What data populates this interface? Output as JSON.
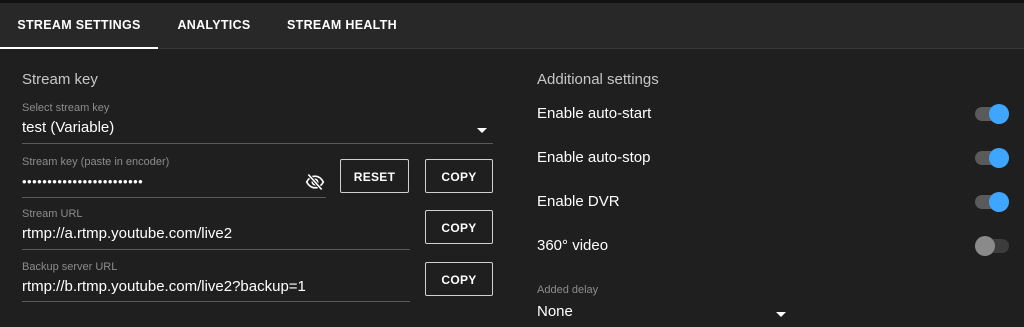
{
  "tabs": [
    {
      "label": "STREAM SETTINGS",
      "active": true
    },
    {
      "label": "ANALYTICS",
      "active": false
    },
    {
      "label": "STREAM HEALTH",
      "active": false
    }
  ],
  "stream_key": {
    "section_title": "Stream key",
    "select": {
      "label": "Select stream key",
      "value": "test (Variable)"
    },
    "key": {
      "label": "Stream key (paste in encoder)",
      "value": "••••••••••••••••••••••••"
    },
    "reset_label": "RESET",
    "copy_key_label": "COPY",
    "url": {
      "label": "Stream URL",
      "value": "rtmp://a.rtmp.youtube.com/live2"
    },
    "copy_url_label": "COPY",
    "backup": {
      "label": "Backup server URL",
      "value": "rtmp://b.rtmp.youtube.com/live2?backup=1"
    },
    "copy_backup_label": "COPY"
  },
  "additional": {
    "section_title": "Additional settings",
    "settings": [
      {
        "label": "Enable auto-start",
        "enabled": true
      },
      {
        "label": "Enable auto-stop",
        "enabled": true
      },
      {
        "label": "Enable DVR",
        "enabled": true
      },
      {
        "label": "360° video",
        "enabled": false
      }
    ],
    "delay": {
      "label": "Added delay",
      "value": "None"
    }
  },
  "colors": {
    "background": "#1f1f1f",
    "tabbar": "#282828",
    "toggle_on": "#3ea6ff",
    "toggle_off": "#8a8a8a"
  }
}
